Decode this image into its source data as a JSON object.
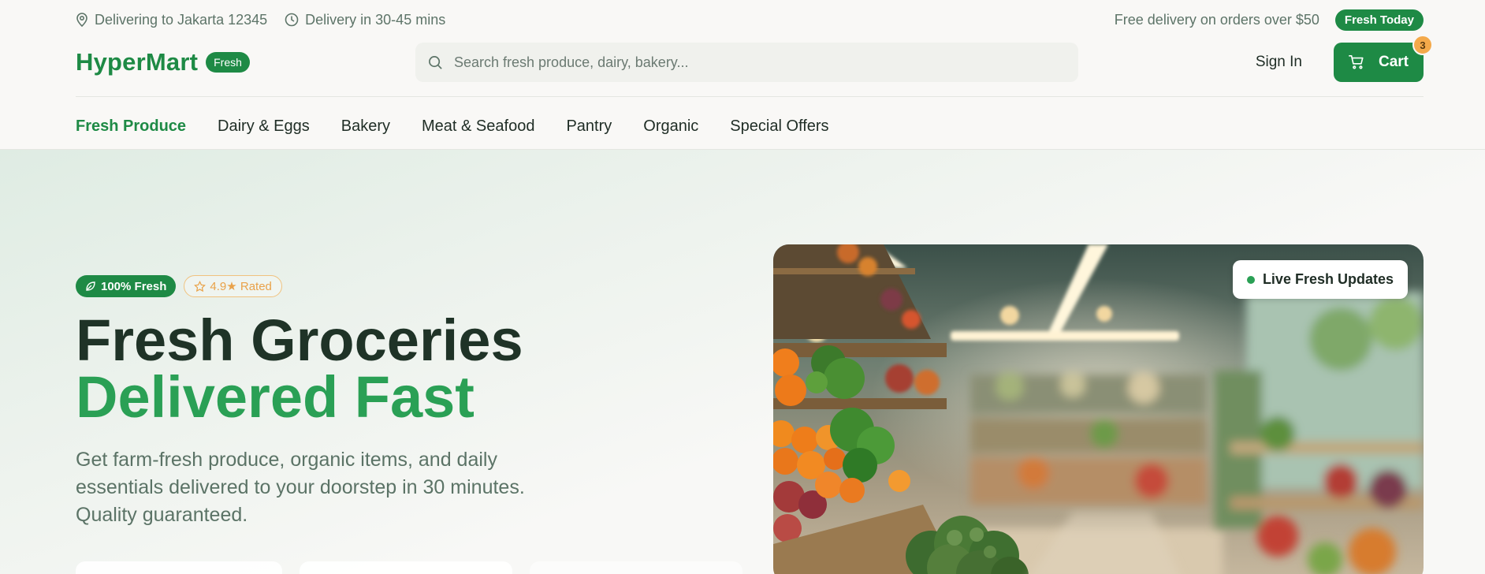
{
  "topbar": {
    "location": "Delivering to Jakarta 12345",
    "delivery_time": "Delivery in 30-45 mins",
    "free_delivery": "Free delivery on orders over $50",
    "fresh_today": "Fresh Today"
  },
  "header": {
    "logo": "HyperMart",
    "logo_badge": "Fresh",
    "search_placeholder": "Search fresh produce, dairy, bakery...",
    "sign_in": "Sign In",
    "cart_label": "Cart",
    "cart_count": "3"
  },
  "nav": {
    "items": [
      "Fresh Produce",
      "Dairy & Eggs",
      "Bakery",
      "Meat & Seafood",
      "Pantry",
      "Organic",
      "Special Offers"
    ],
    "active_index": 0
  },
  "hero": {
    "badge_fresh": "100% Fresh",
    "badge_rated": "4.9★ Rated",
    "title_line1": "Fresh Groceries",
    "title_line2": "Delivered Fast",
    "subtitle": "Get farm-fresh produce, organic items, and daily essentials delivered to your doorstep in 30 minutes. Quality guaranteed.",
    "live_label": "Live Fresh Updates"
  },
  "colors": {
    "brand": "#1e8a45",
    "accent_light": "#2aa055",
    "rating": "#e9a24a"
  }
}
